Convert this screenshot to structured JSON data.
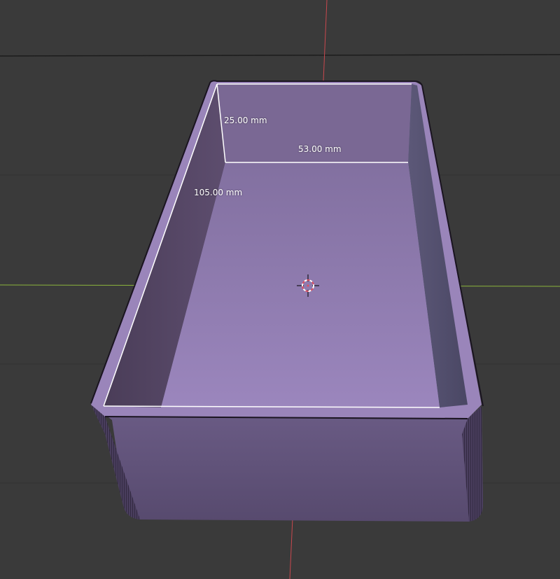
{
  "viewport": {
    "background": "#3a3a3a",
    "grid_color": "#303030",
    "horizon_color": "#1f1f1f",
    "x_axis_color": "#8bb43c",
    "y_axis_color": "#c8484e"
  },
  "object": {
    "base_color": "#8f78ad",
    "edge_color": "#ffffff",
    "wire_color": "#1a1420"
  },
  "measurements": {
    "depth_label": "25.00 mm",
    "width_label": "53.00 mm",
    "length_label": "105.00 mm"
  },
  "cursor": {
    "icon": "3d-cursor-icon",
    "ring_color_a": "#e05060",
    "ring_color_b": "#ffffff"
  }
}
